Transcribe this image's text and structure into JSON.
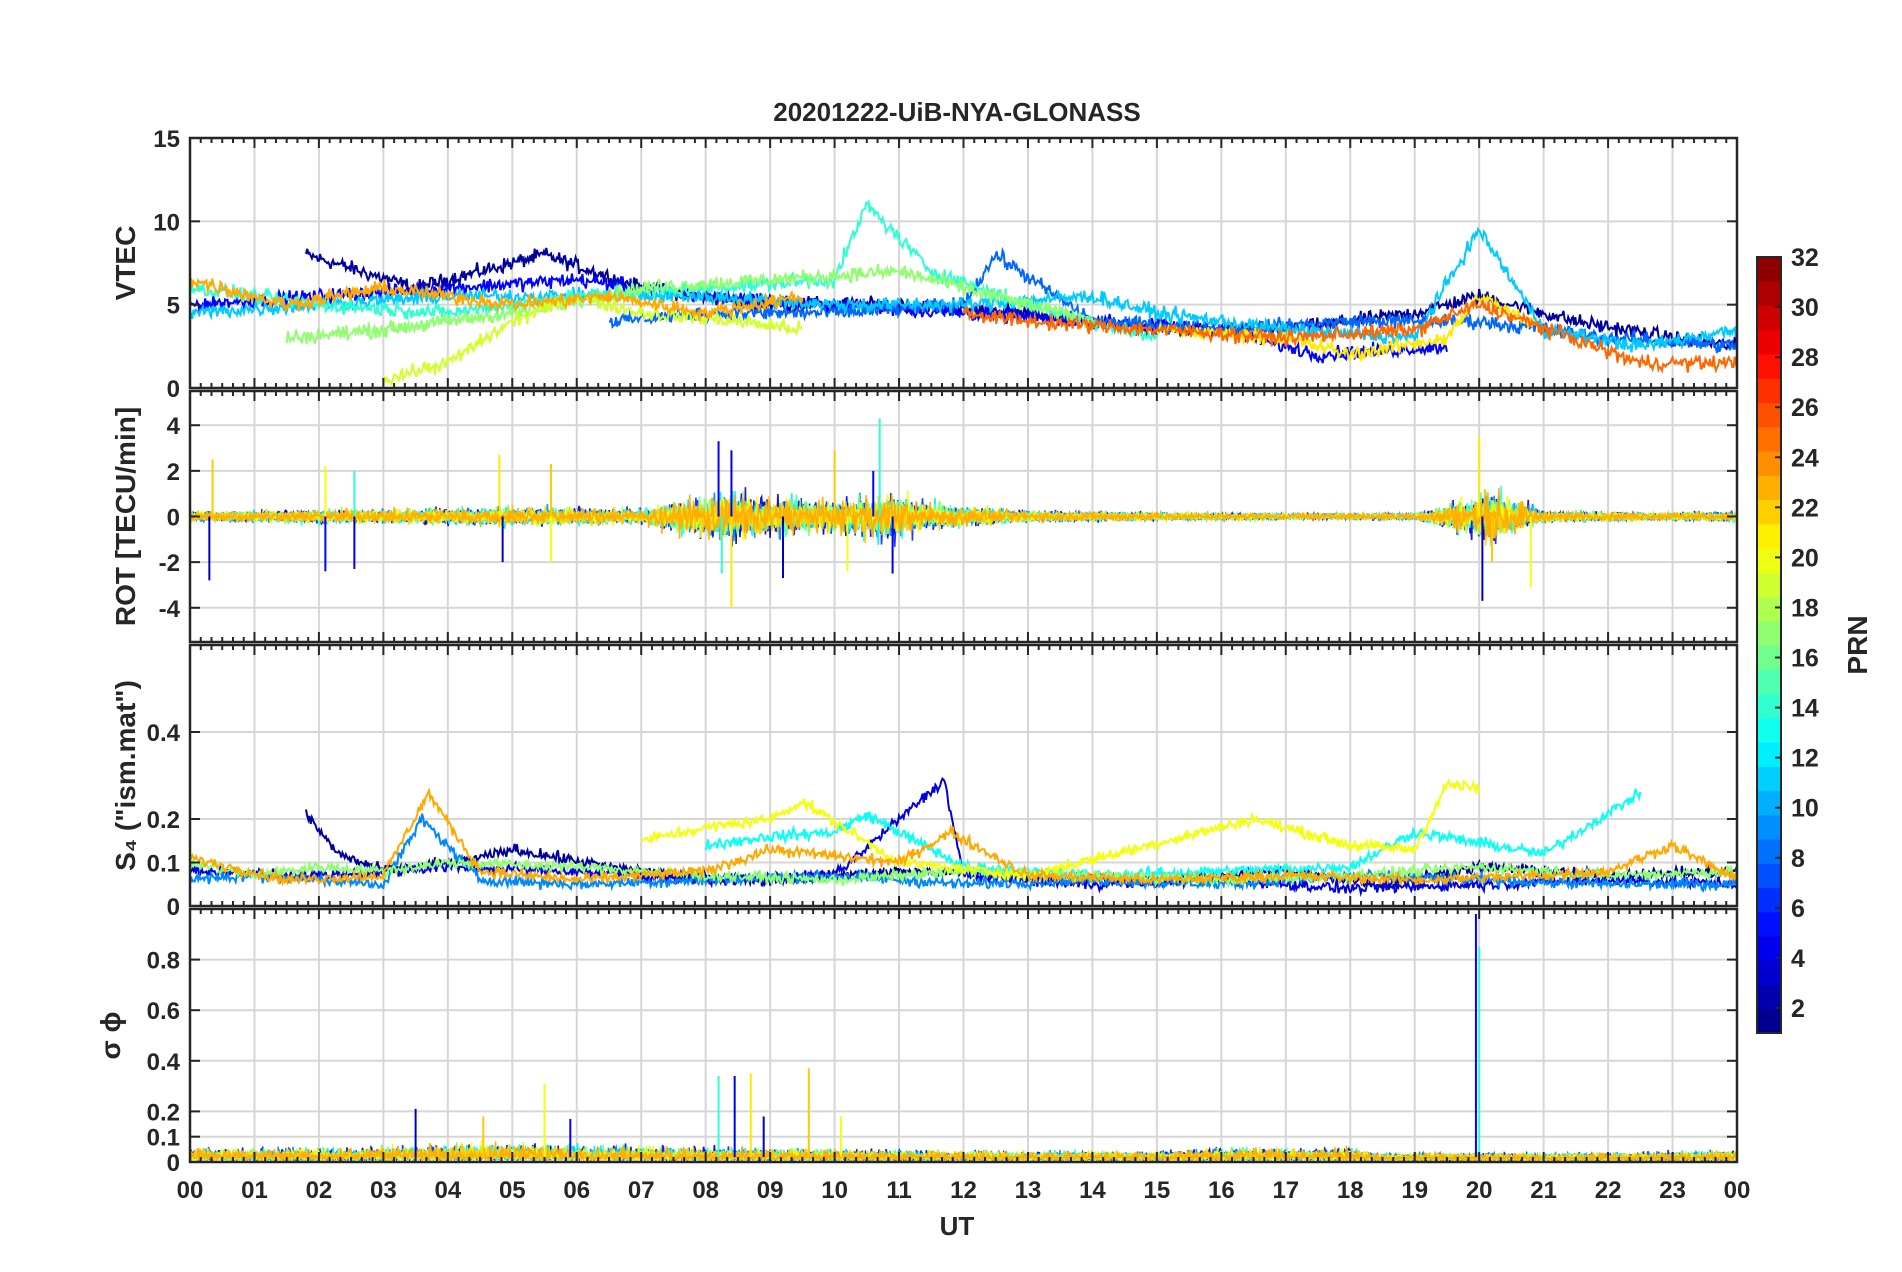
{
  "chart_data": {
    "type": "line",
    "title": "20201222-UiB-NYA-GLONASS",
    "xlabel": "UT",
    "xlim": [
      0,
      24
    ],
    "x_tick_labels": [
      "00",
      "01",
      "02",
      "03",
      "04",
      "05",
      "06",
      "07",
      "08",
      "09",
      "10",
      "11",
      "12",
      "13",
      "14",
      "15",
      "16",
      "17",
      "18",
      "19",
      "20",
      "21",
      "22",
      "23",
      "00"
    ],
    "colorbar": {
      "label": "PRN",
      "range": [
        1,
        32
      ],
      "tick_labels": [
        "2",
        "4",
        "6",
        "8",
        "10",
        "12",
        "14",
        "16",
        "18",
        "20",
        "22",
        "24",
        "26",
        "28",
        "30",
        "32"
      ]
    },
    "panels": [
      {
        "name": "vtec",
        "ylabel": "VTEC",
        "ylim": [
          0,
          15
        ],
        "y_ticks": [
          0,
          5,
          10,
          15
        ],
        "y_tick_labels": [
          "0",
          "5",
          "10",
          "15"
        ],
        "series": [
          {
            "prn": 2,
            "x": [
              1.8,
              3.5,
              5.5,
              7.0,
              9.0,
              11.0,
              13.0,
              15.0,
              17.0,
              19.0,
              20.0,
              21.5,
              23.0,
              24.0
            ],
            "y": [
              8.0,
              6.0,
              8.0,
              6.0,
              5.0,
              5.0,
              4.5,
              3.5,
              3.5,
              4.5,
              5.5,
              4.0,
              3.0,
              2.5
            ]
          },
          {
            "prn": 5,
            "x": [
              0,
              2.0,
              4.0,
              6.0,
              8.0,
              10.0,
              12.0,
              14.0,
              16.0,
              17.5,
              19.5
            ],
            "y": [
              5.0,
              5.5,
              6.0,
              6.5,
              5.5,
              5.0,
              4.5,
              4.0,
              3.5,
              2.0,
              2.5
            ]
          },
          {
            "prn": 8,
            "x": [
              6.5,
              8.0,
              10.0,
              12.0,
              12.5,
              14.0,
              16.0,
              18.0,
              20.0,
              22.0,
              24.0
            ],
            "y": [
              4.0,
              4.5,
              4.5,
              5.0,
              8.0,
              4.0,
              3.5,
              4.0,
              4.0,
              3.0,
              2.5
            ]
          },
          {
            "prn": 11,
            "x": [
              0,
              2.0,
              4.0,
              6.0,
              8.0,
              10.0,
              12.0,
              14.0,
              15.0,
              17.0,
              19.0,
              20.0,
              21.0,
              22.5,
              24.0
            ],
            "y": [
              4.5,
              5.0,
              5.5,
              5.5,
              5.5,
              5.0,
              5.0,
              5.5,
              4.5,
              3.5,
              3.0,
              9.5,
              3.5,
              2.5,
              3.5
            ]
          },
          {
            "prn": 14,
            "x": [
              0,
              2.0,
              4.0,
              6.0,
              8.0,
              10.0,
              10.5,
              11.5,
              13.0,
              15.0
            ],
            "y": [
              6.0,
              5.0,
              4.5,
              5.5,
              6.0,
              6.5,
              11.0,
              7.0,
              5.0,
              3.0
            ]
          },
          {
            "prn": 17,
            "x": [
              1.5,
              3.0,
              5.0,
              7.0,
              9.0,
              11.0,
              12.5,
              14.0
            ],
            "y": [
              3.0,
              3.5,
              4.5,
              6.0,
              6.5,
              7.0,
              5.5,
              4.0
            ]
          },
          {
            "prn": 19,
            "x": [
              3.0,
              4.0,
              5.0,
              6.0,
              7.0,
              8.5,
              9.5
            ],
            "y": [
              0.5,
              1.5,
              4.0,
              5.5,
              4.5,
              4.0,
              3.5
            ]
          },
          {
            "prn": 21,
            "x": [
              15.0,
              17.0,
              18.0,
              19.5,
              20.0,
              21.0
            ],
            "y": [
              3.5,
              3.0,
              2.0,
              3.0,
              5.5,
              3.5
            ]
          },
          {
            "prn": 23,
            "x": [
              0,
              1.5,
              3.0,
              5.0,
              6.5,
              8.0,
              9.5
            ],
            "y": [
              6.5,
              5.0,
              6.0,
              5.0,
              5.5,
              4.5,
              5.5
            ]
          },
          {
            "prn": 25,
            "x": [
              12.0,
              13.0,
              15.0,
              17.0,
              19.0,
              20.0,
              22.5,
              24.0
            ],
            "y": [
              4.5,
              4.0,
              3.5,
              3.0,
              3.5,
              5.0,
              1.5,
              1.5
            ]
          }
        ]
      },
      {
        "name": "rot",
        "ylabel": "ROT [TECU/min]",
        "ylim": [
          -5.5,
          5.5
        ],
        "y_ticks": [
          -4,
          -2,
          0,
          2,
          4
        ],
        "y_tick_labels": [
          "-4",
          "-2",
          "0",
          "2",
          "4"
        ],
        "activity_profile": {
          "x": [
            0,
            2.0,
            3.5,
            5.0,
            7.0,
            8.3,
            9.0,
            10.0,
            10.8,
            11.5,
            13.0,
            15.0,
            17.0,
            19.0,
            19.9,
            20.1,
            21.0,
            22.5,
            24.0
          ],
          "amplitude": [
            0.5,
            0.7,
            0.8,
            1.0,
            0.8,
            2.8,
            2.0,
            1.6,
            2.5,
            1.4,
            0.6,
            0.4,
            0.3,
            0.3,
            2.0,
            3.0,
            0.6,
            0.4,
            0.5
          ]
        },
        "spikes": [
          {
            "x": 0.3,
            "y": -2.8
          },
          {
            "x": 0.35,
            "y": 2.5
          },
          {
            "x": 2.1,
            "y": 2.2
          },
          {
            "x": 2.1,
            "y": -2.4
          },
          {
            "x": 2.55,
            "y": 2.0
          },
          {
            "x": 2.55,
            "y": -2.3
          },
          {
            "x": 4.8,
            "y": 2.7
          },
          {
            "x": 4.85,
            "y": -2.0
          },
          {
            "x": 5.6,
            "y": 2.3
          },
          {
            "x": 5.6,
            "y": -2.0
          },
          {
            "x": 8.2,
            "y": 3.3
          },
          {
            "x": 8.25,
            "y": -2.5
          },
          {
            "x": 8.4,
            "y": 2.9
          },
          {
            "x": 8.4,
            "y": -4.0
          },
          {
            "x": 9.2,
            "y": -2.7
          },
          {
            "x": 10.0,
            "y": 2.9
          },
          {
            "x": 10.2,
            "y": -2.4
          },
          {
            "x": 10.6,
            "y": 2.0
          },
          {
            "x": 10.7,
            "y": 4.3
          },
          {
            "x": 10.9,
            "y": -2.5
          },
          {
            "x": 20.0,
            "y": 3.5
          },
          {
            "x": 20.05,
            "y": -3.7
          },
          {
            "x": 20.2,
            "y": -2.0
          },
          {
            "x": 20.8,
            "y": -3.1
          }
        ]
      },
      {
        "name": "s4",
        "ylabel": "S₄ (\"ism.mat\")",
        "ylim": [
          0,
          0.6
        ],
        "y_ticks": [
          0,
          0.1,
          0.2,
          0.4
        ],
        "y_tick_labels": [
          "0",
          "0.1",
          "0.2",
          "0.4"
        ],
        "series": [
          {
            "prn": 2,
            "x": [
              1.8,
              2.3,
              3.0,
              4.5,
              5.0,
              6.5,
              7.5,
              9.0,
              11.0,
              13.0,
              15.0,
              17.0,
              18.5,
              20.0,
              22.0,
              24.0
            ],
            "y": [
              0.21,
              0.12,
              0.08,
              0.11,
              0.13,
              0.09,
              0.07,
              0.06,
              0.08,
              0.07,
              0.06,
              0.08,
              0.05,
              0.09,
              0.07,
              0.08
            ]
          },
          {
            "prn": 4,
            "x": [
              0,
              2.0,
              4.0,
              6.0,
              8.0,
              10.0,
              11.7,
              12.0,
              14.0,
              16.0,
              18.0,
              20.0,
              22.0,
              24.0
            ],
            "y": [
              0.08,
              0.07,
              0.09,
              0.08,
              0.06,
              0.07,
              0.29,
              0.07,
              0.05,
              0.06,
              0.04,
              0.05,
              0.06,
              0.05
            ]
          },
          {
            "prn": 9,
            "x": [
              0,
              1.0,
              3.0,
              3.6,
              4.5,
              6.0,
              8.0,
              10.0,
              12.0,
              14.0,
              16.0,
              18.0,
              20.0,
              22.0,
              24.0
            ],
            "y": [
              0.06,
              0.07,
              0.05,
              0.2,
              0.06,
              0.05,
              0.06,
              0.07,
              0.05,
              0.06,
              0.05,
              0.07,
              0.06,
              0.05,
              0.05
            ]
          },
          {
            "prn": 13,
            "x": [
              8.0,
              9.0,
              10.0,
              10.5,
              12.0,
              14.0,
              16.0,
              18.0,
              19.0,
              21.0,
              22.5
            ],
            "y": [
              0.14,
              0.16,
              0.17,
              0.21,
              0.09,
              0.07,
              0.08,
              0.09,
              0.17,
              0.12,
              0.26
            ]
          },
          {
            "prn": 17,
            "x": [
              0,
              1.0,
              2.0,
              3.0,
              4.0,
              6.0,
              8.0,
              10.0,
              12.0,
              14.0,
              16.0,
              18.0,
              20.0,
              22.0,
              24.0
            ],
            "y": [
              0.1,
              0.07,
              0.09,
              0.08,
              0.1,
              0.09,
              0.07,
              0.06,
              0.08,
              0.07,
              0.06,
              0.07,
              0.09,
              0.07,
              0.08
            ]
          },
          {
            "prn": 20,
            "x": [
              7.0,
              8.0,
              9.0,
              9.5,
              11.0,
              13.0,
              16.5,
              18.0,
              19.0,
              19.5,
              20.0
            ],
            "y": [
              0.15,
              0.18,
              0.2,
              0.24,
              0.1,
              0.07,
              0.2,
              0.14,
              0.13,
              0.28,
              0.27
            ]
          },
          {
            "prn": 23,
            "x": [
              0,
              1.5,
              3.0,
              3.7,
              4.5,
              6.0,
              8.0,
              9.0,
              11.0,
              11.8,
              13.0,
              15.0,
              17.0,
              19.0,
              21.0,
              22.0,
              23.0,
              24.0
            ],
            "y": [
              0.11,
              0.06,
              0.07,
              0.26,
              0.08,
              0.06,
              0.08,
              0.13,
              0.1,
              0.17,
              0.07,
              0.06,
              0.07,
              0.06,
              0.07,
              0.08,
              0.14,
              0.06
            ]
          }
        ]
      },
      {
        "name": "sigma_phi",
        "ylabel": "σ ϕ",
        "ylim": [
          0,
          1.0
        ],
        "y_ticks": [
          0,
          0.1,
          0.2,
          0.4,
          0.6,
          0.8
        ],
        "y_tick_labels": [
          "0",
          "0.1",
          "0.2",
          "0.4",
          "0.6",
          "0.8"
        ],
        "activity_profile": {
          "x": [
            0,
            2.0,
            3.5,
            5.0,
            6.5,
            8.0,
            9.5,
            11.0,
            13.0,
            15.0,
            16.0,
            18.0,
            18.5,
            20.0,
            21.0,
            22.5,
            24.0
          ],
          "amplitude": [
            0.1,
            0.1,
            0.12,
            0.14,
            0.12,
            0.1,
            0.1,
            0.08,
            0.07,
            0.07,
            0.1,
            0.1,
            0.05,
            0.06,
            0.05,
            0.06,
            0.08
          ]
        },
        "spikes": [
          {
            "x": 3.5,
            "y": 0.21
          },
          {
            "x": 4.55,
            "y": 0.18
          },
          {
            "x": 5.5,
            "y": 0.31
          },
          {
            "x": 5.9,
            "y": 0.17
          },
          {
            "x": 8.2,
            "y": 0.34
          },
          {
            "x": 8.45,
            "y": 0.34
          },
          {
            "x": 8.7,
            "y": 0.35
          },
          {
            "x": 8.9,
            "y": 0.18
          },
          {
            "x": 9.6,
            "y": 0.37
          },
          {
            "x": 10.1,
            "y": 0.18
          },
          {
            "x": 19.95,
            "y": 0.98
          },
          {
            "x": 20.0,
            "y": 0.85
          }
        ]
      }
    ]
  }
}
